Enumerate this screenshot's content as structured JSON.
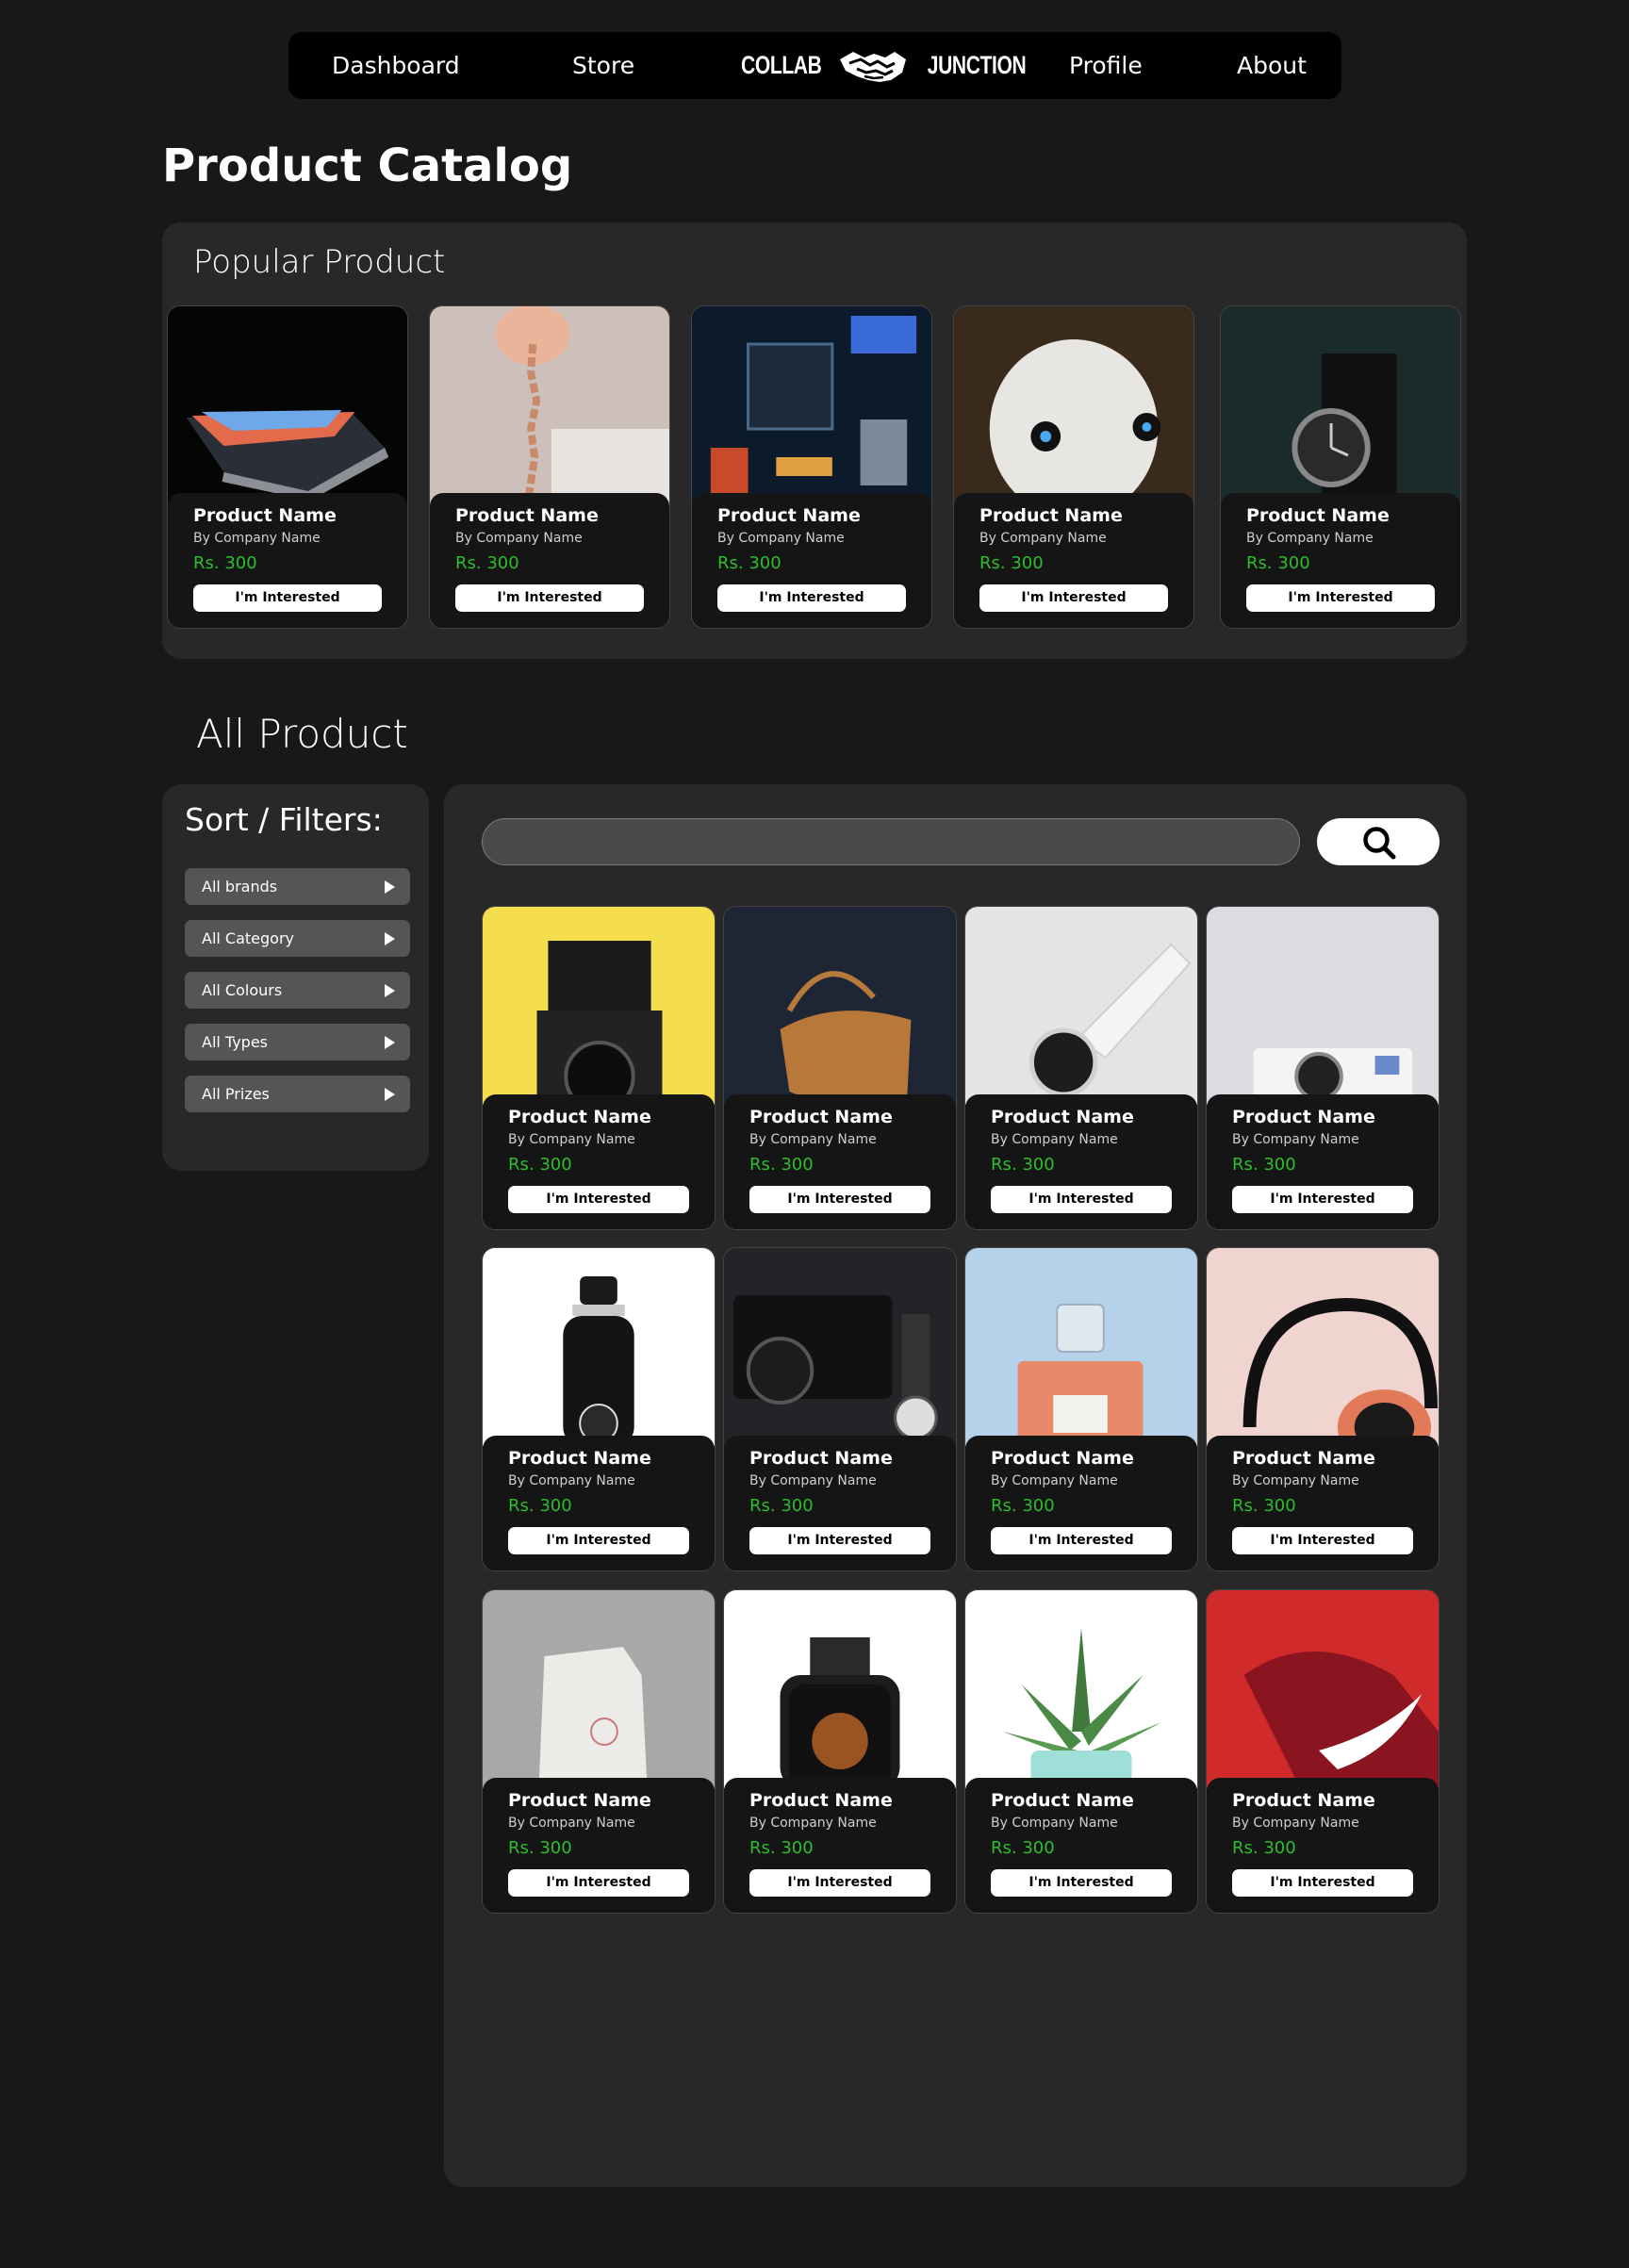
{
  "nav": {
    "dashboard": "Dashboard",
    "store": "Store",
    "profile": "Profile",
    "about": "About",
    "logo_left": "COLLAB",
    "logo_right": "JUNCTION"
  },
  "page_title": "Product Catalog",
  "popular": {
    "title": "Popular Product",
    "products": [
      {
        "name": "Product Name",
        "company": "By Company Name",
        "price": "Rs. 300",
        "button": "I'm Interested"
      },
      {
        "name": "Product Name",
        "company": "By Company Name",
        "price": "Rs. 300",
        "button": "I'm Interested"
      },
      {
        "name": "Product Name",
        "company": "By Company Name",
        "price": "Rs. 300",
        "button": "I'm Interested"
      },
      {
        "name": "Product Name",
        "company": "By Company Name",
        "price": "Rs. 300",
        "button": "I'm Interested"
      },
      {
        "name": "Product Name",
        "company": "By Company Name",
        "price": "Rs. 300",
        "button": "I'm Interested"
      }
    ]
  },
  "all_products": {
    "title": "All Product",
    "products": [
      {
        "name": "Product Name",
        "company": "By Company Name",
        "price": "Rs. 300",
        "button": "I'm Interested"
      },
      {
        "name": "Product Name",
        "company": "By Company Name",
        "price": "Rs. 300",
        "button": "I'm Interested"
      },
      {
        "name": "Product Name",
        "company": "By Company Name",
        "price": "Rs. 300",
        "button": "I'm Interested"
      },
      {
        "name": "Product Name",
        "company": "By Company Name",
        "price": "Rs. 300",
        "button": "I'm Interested"
      },
      {
        "name": "Product Name",
        "company": "By Company Name",
        "price": "Rs. 300",
        "button": "I'm Interested"
      },
      {
        "name": "Product Name",
        "company": "By Company Name",
        "price": "Rs. 300",
        "button": "I'm Interested"
      },
      {
        "name": "Product Name",
        "company": "By Company Name",
        "price": "Rs. 300",
        "button": "I'm Interested"
      },
      {
        "name": "Product Name",
        "company": "By Company Name",
        "price": "Rs. 300",
        "button": "I'm Interested"
      },
      {
        "name": "Product Name",
        "company": "By Company Name",
        "price": "Rs. 300",
        "button": "I'm Interested"
      },
      {
        "name": "Product Name",
        "company": "By Company Name",
        "price": "Rs. 300",
        "button": "I'm Interested"
      },
      {
        "name": "Product Name",
        "company": "By Company Name",
        "price": "Rs. 300",
        "button": "I'm Interested"
      },
      {
        "name": "Product Name",
        "company": "By Company Name",
        "price": "Rs. 300",
        "button": "I'm Interested"
      }
    ]
  },
  "filters": {
    "title": "Sort / Filters:",
    "items": [
      "All brands",
      "All Category",
      "All Colours",
      "All Types",
      "All Prizes"
    ]
  },
  "search": {
    "placeholder": "",
    "icon": "search-icon"
  },
  "colors": {
    "background": "#181818",
    "panel": "#282828",
    "price_green": "#2dbd2d",
    "button_white": "#ffffff"
  }
}
